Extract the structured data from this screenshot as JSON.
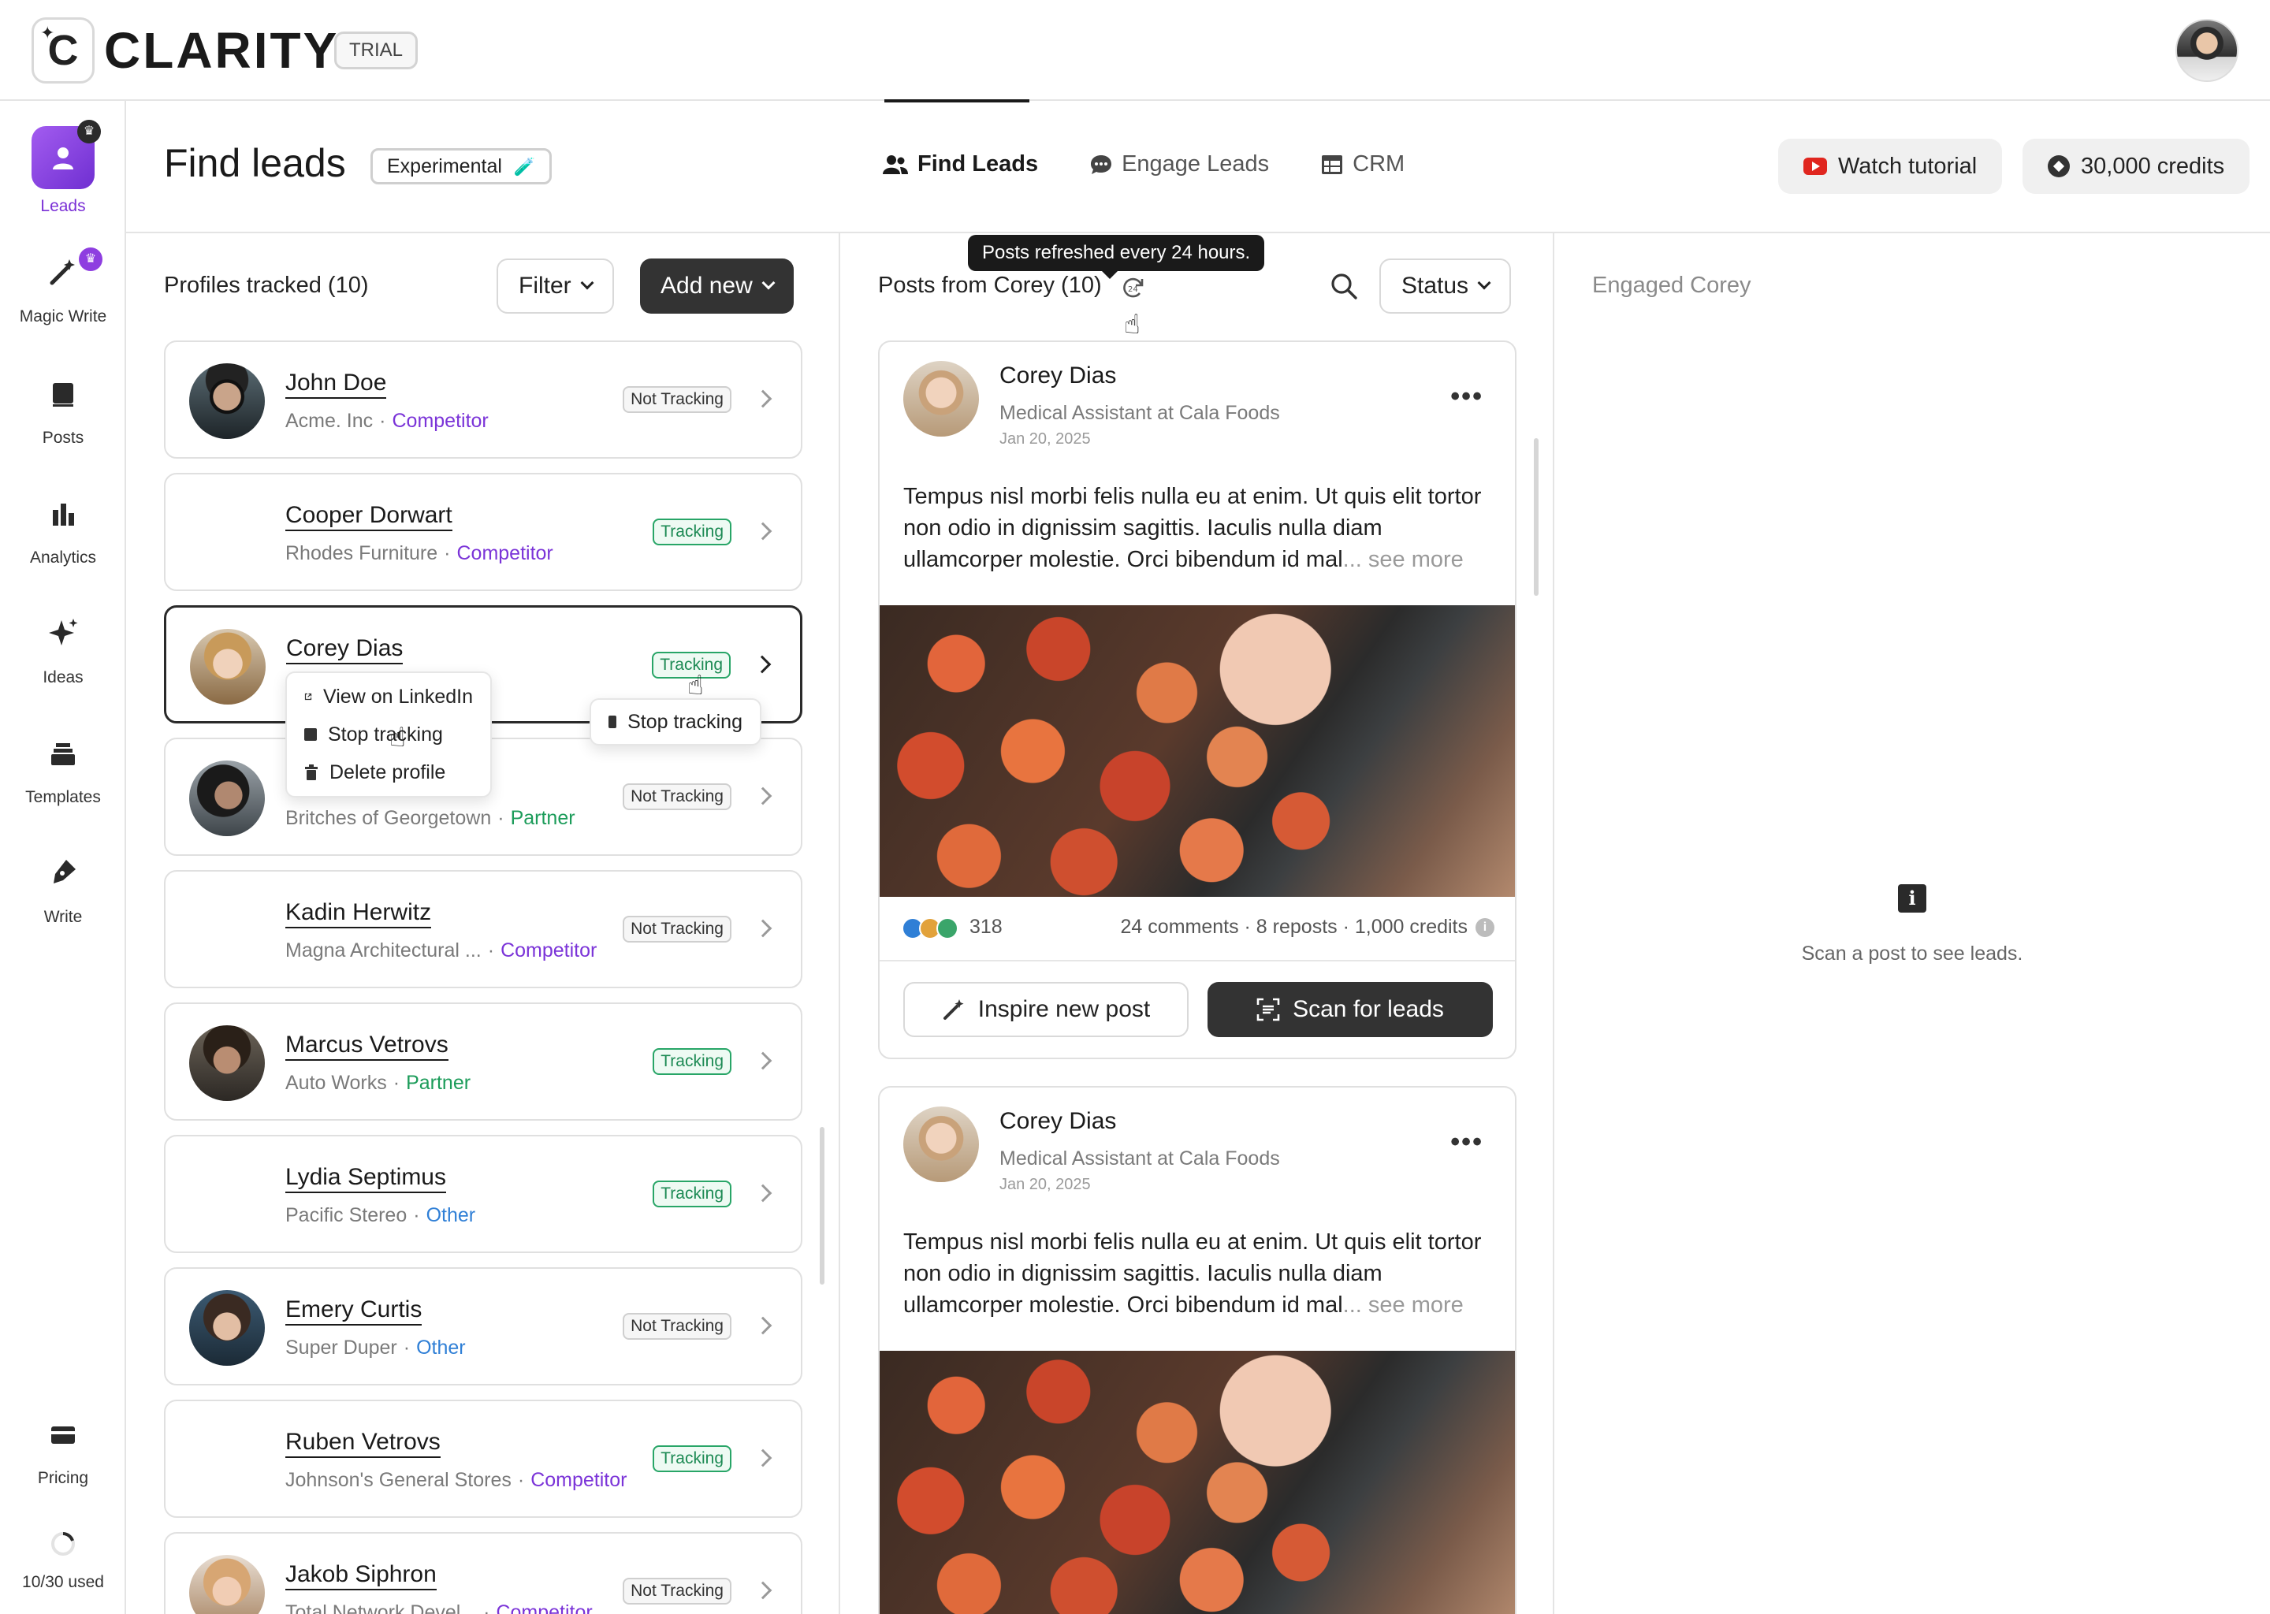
{
  "app": {
    "logo_letter": "C",
    "name": "CLARITY",
    "plan_badge": "TRIAL"
  },
  "sidebar": {
    "items": [
      {
        "label": "Leads",
        "icon": "leads-icon",
        "active": true
      },
      {
        "label": "Magic Write",
        "icon": "magic-wand-icon"
      },
      {
        "label": "Posts",
        "icon": "posts-icon"
      },
      {
        "label": "Analytics",
        "icon": "bar-chart-icon"
      },
      {
        "label": "Ideas",
        "icon": "sparkle-icon"
      },
      {
        "label": "Templates",
        "icon": "stack-icon"
      },
      {
        "label": "Write",
        "icon": "pen-icon"
      }
    ],
    "pricing_label": "Pricing",
    "usage_label": "10/30 used"
  },
  "header": {
    "title": "Find leads",
    "badge": "Experimental",
    "tabs": [
      {
        "label": "Find Leads",
        "active": true
      },
      {
        "label": "Engage Leads"
      },
      {
        "label": "CRM"
      }
    ],
    "tutorial_button": "Watch tutorial",
    "credits_button": "30,000 credits"
  },
  "profiles": {
    "title": "Profiles tracked (10)",
    "filter_label": "Filter",
    "add_label": "Add new",
    "items": [
      {
        "name": "John Doe",
        "company": "Acme. Inc",
        "role": "Competitor",
        "status": "Not Tracking"
      },
      {
        "name": "Cooper Dorwart",
        "company": "Rhodes Furniture",
        "role": "Competitor",
        "status": "Tracking"
      },
      {
        "name": "Corey Dias",
        "company": "",
        "role": "",
        "status": "Tracking"
      },
      {
        "name": "",
        "company": "Britches of Georgetown",
        "role": "Partner",
        "status": "Not Tracking"
      },
      {
        "name": "Kadin Herwitz",
        "company": "Magna Architectural ...",
        "role": "Competitor",
        "status": "Not Tracking"
      },
      {
        "name": "Marcus Vetrovs",
        "company": "Auto Works",
        "role": "Partner",
        "status": "Tracking"
      },
      {
        "name": "Lydia Septimus",
        "company": "Pacific Stereo",
        "role": "Other",
        "status": "Tracking"
      },
      {
        "name": "Emery Curtis",
        "company": "Super Duper",
        "role": "Other",
        "status": "Not Tracking"
      },
      {
        "name": "Ruben Vetrovs",
        "company": "Johnson's General Stores",
        "role": "Competitor",
        "status": "Tracking"
      },
      {
        "name": "Jakob Siphron",
        "company": "Total Network Devel...",
        "role": "Competitor",
        "status": "Not Tracking"
      }
    ],
    "context_menu": {
      "view": "View on LinkedIn",
      "stop": "Stop tracking",
      "delete": "Delete profile"
    },
    "hover_menu_stop": "Stop tracking"
  },
  "posts": {
    "title": "Posts from Corey (10)",
    "tooltip": "Posts refreshed every 24 hours.",
    "status_label": "Status",
    "items": [
      {
        "author": "Corey Dias",
        "role": "Medical Assistant at Cala Foods",
        "date": "Jan 20, 2025",
        "text": "Tempus nisl morbi felis nulla eu at enim. Ut quis elit tortor non odio in dignissim sagittis. Iaculis nulla diam ullamcorper molestie. Orci bibendum id mal",
        "see_more": "... see more",
        "reactions": "318",
        "stats": "24 comments · 8 reposts · 1,000 credits",
        "inspire_label": "Inspire new post",
        "scan_label": "Scan for leads"
      },
      {
        "author": "Corey Dias",
        "role": "Medical Assistant at Cala Foods",
        "date": "Jan 20, 2025",
        "text": "Tempus nisl morbi felis nulla eu at enim. Ut quis elit tortor non odio in dignissim sagittis. Iaculis nulla diam ullamcorper molestie. Orci bibendum id mal",
        "see_more": "... see more"
      }
    ]
  },
  "engaged": {
    "title": "Engaged Corey",
    "empty_text": "Scan a post to see leads."
  }
}
